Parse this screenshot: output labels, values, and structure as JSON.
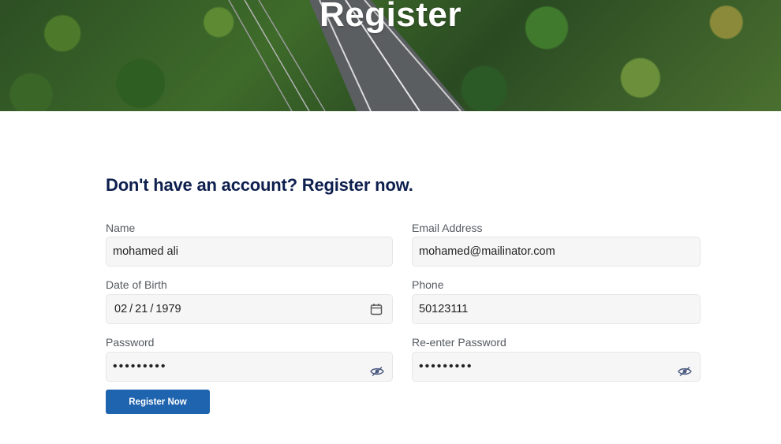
{
  "hero": {
    "title": "Register"
  },
  "form": {
    "heading": "Don't have an account? Register now.",
    "name": {
      "label": "Name",
      "value": "mohamed ali"
    },
    "email": {
      "label": "Email Address",
      "value": "mohamed@mailinator.com"
    },
    "dob": {
      "label": "Date of Birth",
      "month": "02",
      "day": "21",
      "year": "1979"
    },
    "phone": {
      "label": "Phone",
      "value": "50123111"
    },
    "password": {
      "label": "Password",
      "value": "•••••••••"
    },
    "confirm_password": {
      "label": "Re-enter Password",
      "value": "•••••••••"
    },
    "submit_label": "Register Now"
  },
  "icons": {
    "calendar": "calendar-icon",
    "toggle_visibility": "eye-icon"
  },
  "colors": {
    "heading": "#0d1f4e",
    "button": "#1f64ae",
    "field_bg": "#f6f6f6"
  }
}
